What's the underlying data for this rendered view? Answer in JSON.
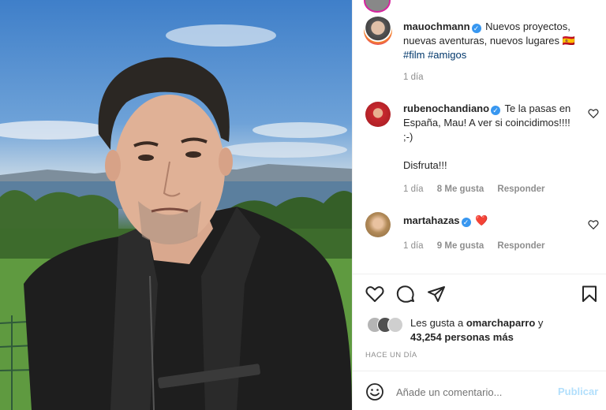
{
  "post": {
    "author": "mauochmann",
    "caption": "Nuevos proyectos, nuevas aventuras, nuevos lugares",
    "caption_flag": "🇪🇸",
    "hashtags": [
      "#film",
      "#amigos"
    ],
    "time": "1 día"
  },
  "comments": [
    {
      "username": "rubenochandiano",
      "text": "Te la pasas en España, Mau! A ver si coincidimos!!!! ;-)",
      "text2": "Disfruta!!!",
      "time": "1 día",
      "likes": "8 Me gusta",
      "reply": "Responder"
    },
    {
      "username": "martahazas",
      "text": "❤️",
      "time": "1 día",
      "likes": "9 Me gusta",
      "reply": "Responder"
    }
  ],
  "icons": {
    "like": "heart-icon",
    "comment": "comment-icon",
    "share": "share-icon",
    "save": "bookmark-icon",
    "emoji": "emoji-icon",
    "verified": "verified-badge-icon"
  },
  "likes": {
    "prefix": "Les gusta a",
    "user": "omarchaparro",
    "conj": "y",
    "count": "43,254 personas más"
  },
  "timestamp": "HACE UN DÍA",
  "composer": {
    "placeholder": "Añade un comentario...",
    "publish_label": "Publicar"
  },
  "colors": {
    "verified": "#3897f0",
    "hashtag": "#00376b",
    "publish_disabled": "#b2dffc",
    "meta": "#8e8e8e"
  }
}
